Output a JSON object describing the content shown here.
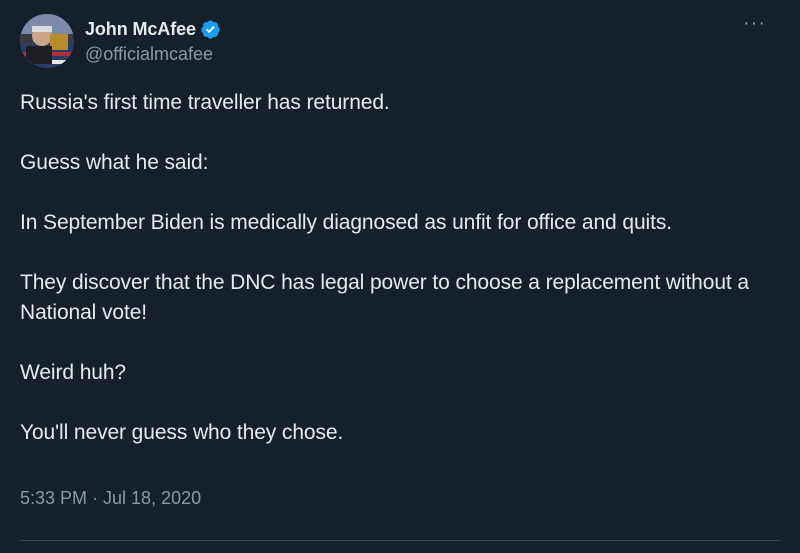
{
  "author": {
    "display_name": "John McAfee",
    "handle": "@officialmcafee",
    "verified": true,
    "verified_color": "#1d9bf0"
  },
  "more_menu": {
    "icon": "more-horizontal-icon",
    "label": "···"
  },
  "tweet": {
    "paragraphs": [
      "Russia's first time traveller has returned.",
      "Guess what he said:",
      "In September Biden is medically diagnosed as unfit for office and quits.",
      "They discover that the DNC has legal power to choose a replacement without a National vote!",
      "Weird huh?",
      "You'll never guess who they chose."
    ],
    "timestamp": "5:33 PM · Jul 18, 2020"
  },
  "theme": {
    "background": "#15202b",
    "text": "#e7e9ea",
    "secondary_text": "#8b98a5"
  }
}
